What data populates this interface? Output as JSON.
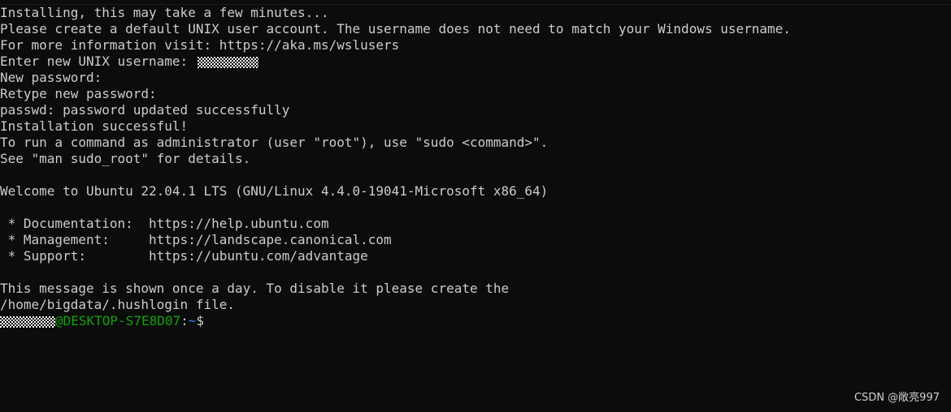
{
  "terminal": {
    "lines": [
      "Installing, this may take a few minutes...",
      "Please create a default UNIX user account. The username does not need to match your Windows username.",
      "For more information visit: https://aka.ms/wslusers",
      "Enter new UNIX username: ",
      "New password:",
      "Retype new password:",
      "passwd: password updated successfully",
      "Installation successful!",
      "To run a command as administrator (user \"root\"), use \"sudo <command>\".",
      "See \"man sudo_root\" for details.",
      "",
      "Welcome to Ubuntu 22.04.1 LTS (GNU/Linux 4.4.0-19041-Microsoft x86_64)",
      "",
      " * Documentation:  https://help.ubuntu.com",
      " * Management:     https://landscape.canonical.com",
      " * Support:        https://ubuntu.com/advantage",
      "",
      "This message is shown once a day. To disable it please create the",
      "/home/bigdata/.hushlogin file."
    ],
    "prompt": {
      "host": "@DESKTOP-S7E8D07",
      "separator": ":",
      "path": "~",
      "sign": "$"
    }
  },
  "watermark": "CSDN @敞亮997",
  "colors": {
    "background": "#0c0c0c",
    "text": "#cccccc",
    "prompt_host": "#13a10e",
    "prompt_path": "#3b78ff"
  }
}
